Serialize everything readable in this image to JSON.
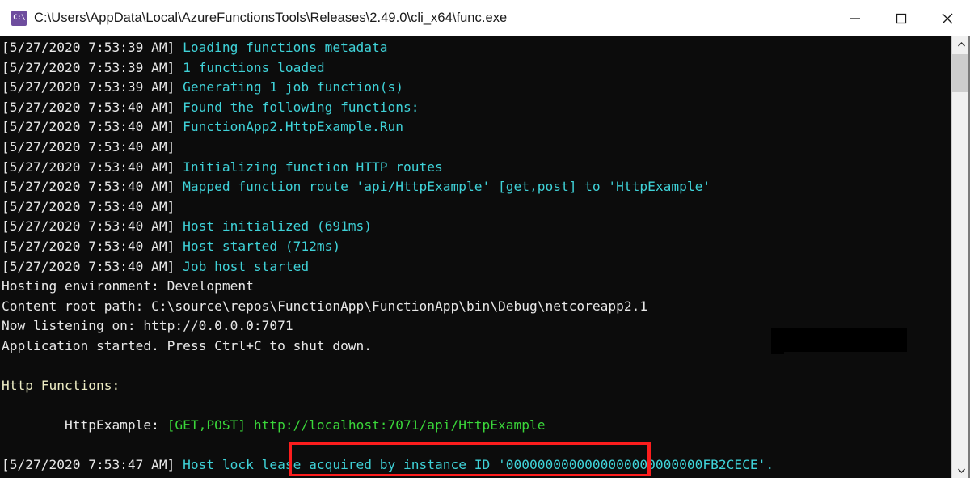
{
  "window": {
    "title": "C:\\Users\\AppData\\Local\\AzureFunctionsTools\\Releases\\2.49.0\\cli_x64\\func.exe",
    "icon_name": "command-prompt-icon",
    "icon_glyph": "C:\\",
    "controls": {
      "minimize_label": "Minimize",
      "maximize_label": "Maximize",
      "close_label": "Close"
    }
  },
  "theme": {
    "terminal_background": "#0c0c0c",
    "timestamp_color": "#e8e8e8",
    "message_color": "#3fd2d8",
    "plain_color": "#e8e8e8",
    "heading_color": "#eeedc4",
    "url_color": "#3ad63a",
    "highlight_border_color": "#fc1d1d",
    "titlebar_background": "#ffffff",
    "title_color": "#1a1a1a",
    "redaction_color": "#000000"
  },
  "terminal": {
    "lines": [
      {
        "timestamp": "[5/27/2020 7:53:39 AM]",
        "message": " Loading functions metadata",
        "style": "cyan"
      },
      {
        "timestamp": "[5/27/2020 7:53:39 AM]",
        "message": " 1 functions loaded",
        "style": "cyan"
      },
      {
        "timestamp": "[5/27/2020 7:53:39 AM]",
        "message": " Generating 1 job function(s)",
        "style": "cyan"
      },
      {
        "timestamp": "[5/27/2020 7:53:40 AM]",
        "message": " Found the following functions:",
        "style": "cyan"
      },
      {
        "timestamp": "[5/27/2020 7:53:40 AM]",
        "message": " FunctionApp2.HttpExample.Run",
        "style": "cyan"
      },
      {
        "timestamp": "[5/27/2020 7:53:40 AM]",
        "message": "",
        "style": "cyan"
      },
      {
        "timestamp": "[5/27/2020 7:53:40 AM]",
        "message": " Initializing function HTTP routes",
        "style": "cyan"
      },
      {
        "timestamp": "[5/27/2020 7:53:40 AM]",
        "message": " Mapped function route 'api/HttpExample' [get,post] to 'HttpExample'",
        "style": "cyan"
      },
      {
        "timestamp": "[5/27/2020 7:53:40 AM]",
        "message": "",
        "style": "cyan"
      },
      {
        "timestamp": "[5/27/2020 7:53:40 AM]",
        "message": " Host initialized (691ms)",
        "style": "cyan"
      },
      {
        "timestamp": "[5/27/2020 7:53:40 AM]",
        "message": " Host started (712ms)",
        "style": "cyan"
      },
      {
        "timestamp": "[5/27/2020 7:53:40 AM]",
        "message": " Job host started",
        "style": "cyan"
      },
      {
        "timestamp": "",
        "message": "Hosting environment: Development",
        "style": "white"
      },
      {
        "timestamp": "",
        "message": "Content root path: C:\\source\\repos\\FunctionApp\\FunctionApp\\bin\\Debug\\netcoreapp2.1",
        "style": "white"
      },
      {
        "timestamp": "",
        "message": "Now listening on: http://0.0.0.0:7071",
        "style": "white"
      },
      {
        "timestamp": "",
        "message": "Application started. Press Ctrl+C to shut down.",
        "style": "white"
      },
      {
        "timestamp": "",
        "message": "",
        "style": "white"
      },
      {
        "timestamp": "",
        "message": "Http Functions:",
        "style": "yellow"
      },
      {
        "timestamp": "",
        "message": "",
        "style": "white"
      }
    ],
    "function_entry": {
      "indent": "        ",
      "name": "HttpExample:",
      "methods": "[GET,POST]",
      "url": "http://localhost:7071/api/HttpExample"
    },
    "blank_after_entry": "",
    "last_line": {
      "timestamp": "[5/27/2020 7:53:47 AM]",
      "message": " Host lock lease acquired by instance ID '0000000000000000000000000FB2CECE'."
    }
  },
  "scrollbar": {
    "up_arrow_name": "scroll-up-arrow",
    "down_arrow_name": "scroll-down-arrow"
  }
}
